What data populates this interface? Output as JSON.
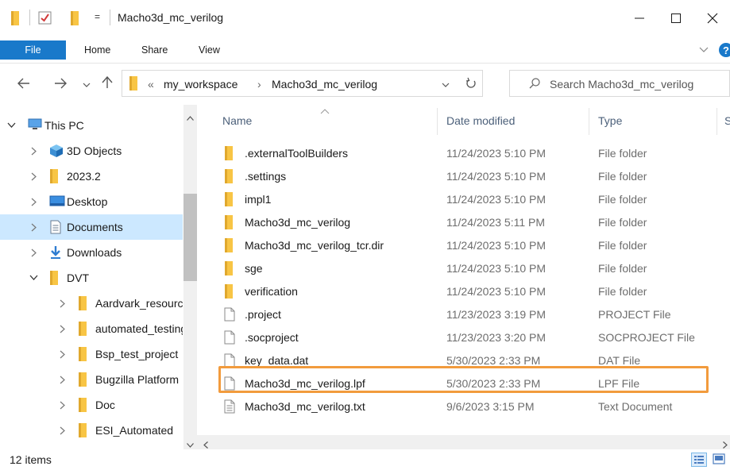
{
  "window": {
    "title": "Macho3d_mc_verilog",
    "qa_dropdown": "="
  },
  "ribbon": {
    "tabs": [
      "File",
      "Home",
      "Share",
      "View"
    ],
    "help": "?"
  },
  "address": {
    "overflow": "«",
    "crumbs": [
      "my_workspace",
      "Macho3d_mc_verilog"
    ],
    "separator": "›"
  },
  "search": {
    "placeholder": "Search Macho3d_mc_verilog"
  },
  "nav": {
    "items": [
      {
        "label": "This PC",
        "icon": "pc-icon",
        "expanded": true,
        "indent": 0
      },
      {
        "label": "3D Objects",
        "icon": "3d-objects-icon",
        "expanded": false,
        "indent": 1
      },
      {
        "label": "2023.2",
        "icon": "folder-icon",
        "expanded": false,
        "indent": 1
      },
      {
        "label": "Desktop",
        "icon": "desktop-icon",
        "expanded": false,
        "indent": 1
      },
      {
        "label": "Documents",
        "icon": "documents-icon",
        "expanded": false,
        "indent": 1,
        "selected": true
      },
      {
        "label": "Downloads",
        "icon": "downloads-icon",
        "expanded": false,
        "indent": 1
      },
      {
        "label": "DVT",
        "icon": "folder-icon",
        "expanded": true,
        "indent": 1
      },
      {
        "label": "Aardvark_resource",
        "icon": "folder-icon",
        "expanded": false,
        "indent": 2
      },
      {
        "label": "automated_testing_",
        "icon": "folder-icon",
        "expanded": false,
        "indent": 2
      },
      {
        "label": "Bsp_test_project",
        "icon": "folder-icon",
        "expanded": false,
        "indent": 2
      },
      {
        "label": "Bugzilla Platform",
        "icon": "folder-icon",
        "expanded": false,
        "indent": 2
      },
      {
        "label": "Doc",
        "icon": "folder-icon",
        "expanded": false,
        "indent": 2
      },
      {
        "label": "ESI_Automated",
        "icon": "folder-icon",
        "expanded": false,
        "indent": 2
      }
    ]
  },
  "columns": {
    "name": "Name",
    "date": "Date modified",
    "type": "Type",
    "size": "S"
  },
  "files": [
    {
      "name": ".externalToolBuilders",
      "date": "11/24/2023 5:10 PM",
      "type": "File folder",
      "icon": "folder-icon"
    },
    {
      "name": ".settings",
      "date": "11/24/2023 5:10 PM",
      "type": "File folder",
      "icon": "folder-icon"
    },
    {
      "name": "impl1",
      "date": "11/24/2023 5:10 PM",
      "type": "File folder",
      "icon": "folder-icon"
    },
    {
      "name": "Macho3d_mc_verilog",
      "date": "11/24/2023 5:11 PM",
      "type": "File folder",
      "icon": "folder-icon"
    },
    {
      "name": "Macho3d_mc_verilog_tcr.dir",
      "date": "11/24/2023 5:10 PM",
      "type": "File folder",
      "icon": "folder-icon"
    },
    {
      "name": "sge",
      "date": "11/24/2023 5:10 PM",
      "type": "File folder",
      "icon": "folder-icon"
    },
    {
      "name": "verification",
      "date": "11/24/2023 5:10 PM",
      "type": "File folder",
      "icon": "folder-icon"
    },
    {
      "name": ".project",
      "date": "11/23/2023 3:19 PM",
      "type": "PROJECT File",
      "icon": "file-icon"
    },
    {
      "name": ".socproject",
      "date": "11/23/2023 3:20 PM",
      "type": "SOCPROJECT File",
      "icon": "file-icon"
    },
    {
      "name": "key_data.dat",
      "date": "5/30/2023 2:33 PM",
      "type": "DAT File",
      "icon": "file-icon"
    },
    {
      "name": "Macho3d_mc_verilog.lpf",
      "date": "5/30/2023 2:33 PM",
      "type": "LPF File",
      "icon": "file-icon",
      "highlighted": true
    },
    {
      "name": "Macho3d_mc_verilog.txt",
      "date": "9/6/2023 3:15 PM",
      "type": "Text Document",
      "icon": "text-file-icon"
    }
  ],
  "status": {
    "count": "12 items"
  },
  "colors": {
    "accent": "#1979ca",
    "folder": "#f8c545",
    "selected": "#cce8ff",
    "highlight": "#f29b3d"
  }
}
